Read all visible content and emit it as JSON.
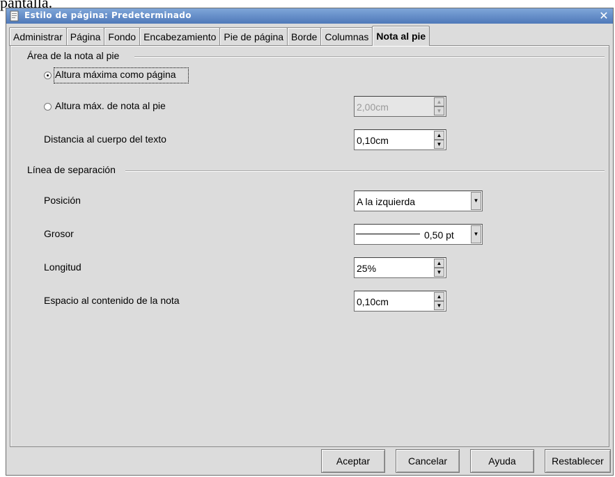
{
  "page_caption": "pantalla.",
  "window": {
    "title": "Estilo de página: Predeterminado",
    "close_glyph": "✕"
  },
  "tabs": [
    "Administrar",
    "Página",
    "Fondo",
    "Encabezamiento",
    "Pie de página",
    "Borde",
    "Columnas",
    "Nota al pie"
  ],
  "active_tab": "Nota al pie",
  "area": {
    "heading": "Área de la nota al pie",
    "radio1": "Altura máxima como página",
    "radio2": "Altura máx. de nota al pie",
    "radio2_value": "2,00cm",
    "distance_label": "Distancia al cuerpo del texto",
    "distance_value": "0,10cm"
  },
  "separator": {
    "heading": "Línea de separación",
    "position_label": "Posición",
    "position_value": "A la izquierda",
    "weight_label": "Grosor",
    "weight_value": "0,50 pt",
    "length_label": "Longitud",
    "length_value": "25%",
    "spacing_label": "Espacio al contenido de la nota",
    "spacing_value": "0,10cm"
  },
  "buttons": {
    "ok": "Aceptar",
    "cancel": "Cancelar",
    "help": "Ayuda",
    "reset": "Restablecer"
  },
  "colors": {
    "titlebar": "#4f79b9",
    "dialog_bg": "#dcdcdc"
  }
}
